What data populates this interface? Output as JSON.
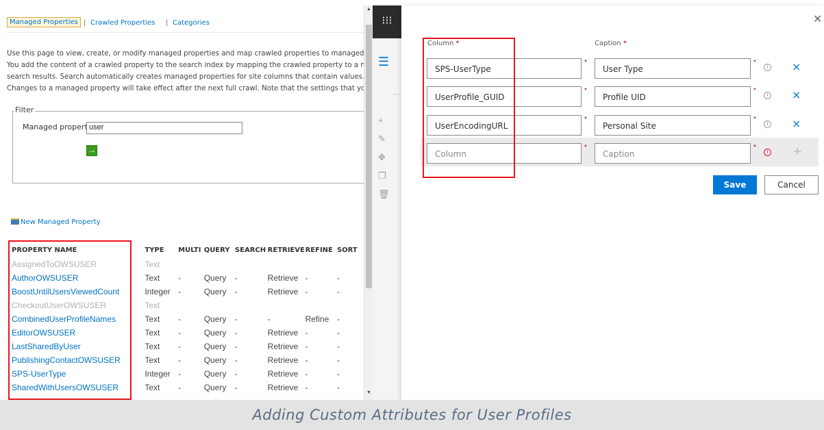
{
  "nav": {
    "active": "Managed Properties",
    "sep1": "|",
    "link2": "Crawled Properties",
    "sep2": "|",
    "link3": "Categories"
  },
  "description": [
    "Use this page to view, create, or modify managed properties and map crawled properties to managed prop",
    "You add the content of a crawled property to the search index by mapping the crawled property to a mana",
    "search results. Search automatically creates managed properties for site columns that contain values. Auto",
    "Changes to a managed property will take effect after the next full crawl. Note that the settings that you ca"
  ],
  "filter": {
    "legend": "Filter",
    "label": "Managed property",
    "value": "user",
    "go_icon": "→"
  },
  "new_property_link": "New Managed Property",
  "table": {
    "headers": [
      "PROPERTY NAME",
      "TYPE",
      "MULTI",
      "QUERY",
      "SEARCH",
      "RETRIEVE",
      "REFINE",
      "SORT"
    ],
    "rows": [
      {
        "name": "AssignedToOWSUSER",
        "type": "Text",
        "multi": "",
        "query": "",
        "search": "",
        "retrieve": "",
        "refine": "",
        "sort": "",
        "greyed": true
      },
      {
        "name": "AuthorOWSUSER",
        "type": "Text",
        "multi": "-",
        "query": "Query",
        "search": "-",
        "retrieve": "Retrieve",
        "refine": "-",
        "sort": "-",
        "greyed": false
      },
      {
        "name": "BoostUntilUsersViewedCount",
        "type": "Integer",
        "multi": "-",
        "query": "Query",
        "search": "-",
        "retrieve": "Retrieve",
        "refine": "-",
        "sort": "-",
        "greyed": false
      },
      {
        "name": "CheckoutUserOWSUSER",
        "type": "Text",
        "multi": "",
        "query": "",
        "search": "",
        "retrieve": "",
        "refine": "",
        "sort": "",
        "greyed": true
      },
      {
        "name": "CombinedUserProfileNames",
        "type": "Text",
        "multi": "-",
        "query": "Query",
        "search": "-",
        "retrieve": "-",
        "refine": "Refine",
        "sort": "-",
        "greyed": false
      },
      {
        "name": "EditorOWSUSER",
        "type": "Text",
        "multi": "-",
        "query": "Query",
        "search": "-",
        "retrieve": "Retrieve",
        "refine": "-",
        "sort": "-",
        "greyed": false
      },
      {
        "name": "LastSharedByUser",
        "type": "Text",
        "multi": "-",
        "query": "Query",
        "search": "-",
        "retrieve": "Retrieve",
        "refine": "-",
        "sort": "-",
        "greyed": false
      },
      {
        "name": "PublishingContactOWSUSER",
        "type": "Text",
        "multi": "-",
        "query": "Query",
        "search": "-",
        "retrieve": "Retrieve",
        "refine": "-",
        "sort": "-",
        "greyed": false
      },
      {
        "name": "SPS-UserType",
        "type": "Integer",
        "multi": "-",
        "query": "Query",
        "search": "-",
        "retrieve": "Retrieve",
        "refine": "-",
        "sort": "-",
        "greyed": false
      },
      {
        "name": "SharedWithUsersOWSUSER",
        "type": "Text",
        "multi": "-",
        "query": "Query",
        "search": "-",
        "retrieve": "Retrieve",
        "refine": "-",
        "sort": "-",
        "greyed": false
      }
    ]
  },
  "panel": {
    "column_header": "Column",
    "caption_header": "Caption",
    "required_mark": "*",
    "rows": [
      {
        "column": "SPS-UserType",
        "caption": "User Type"
      },
      {
        "column": "UserProfile_GUID",
        "caption": "Profile UID"
      },
      {
        "column": "UserEncodingURL",
        "caption": "Personal Site"
      }
    ],
    "new_row": {
      "column_placeholder": "Column",
      "caption_placeholder": "Caption"
    },
    "save_label": "Save",
    "cancel_label": "Cancel",
    "close_icon": "close-icon",
    "info_icon_glyph": "i",
    "delete_glyph": "×",
    "add_glyph": "+"
  },
  "caption": "Adding Custom Attributes for User Profiles",
  "colors": {
    "accent": "#0078d4",
    "highlight_box": "#e8141c",
    "link": "#0072c6"
  }
}
